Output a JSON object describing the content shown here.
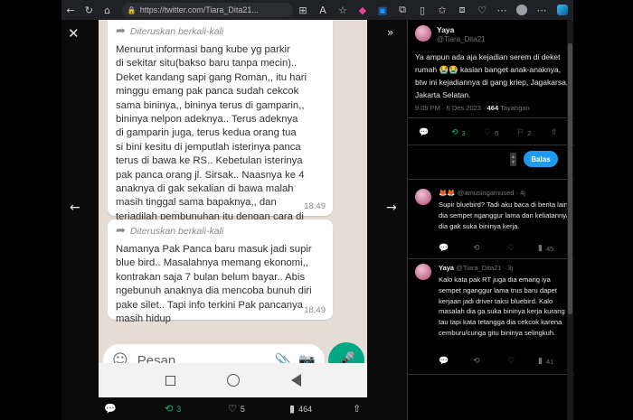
{
  "browser": {
    "url": "https://twitter.com/Tiara_Dita21..."
  },
  "whatsapp": {
    "forward_label_1": "Diteruskan berkali-kali",
    "message_1": "Menurut informasi bang kube yg parkir\ndi sekitar situ(bakso baru tanpa mecin)..\nDeket kandang sapi gang Roman,, itu hari\nminggu emang pak panca sudah cekcok\nsama bininya,, bininya terus di gamparin,,\nbininya nelpon adeknya.. Terus adeknya\ndi gamparin juga, terus kedua orang tua\nsi bini kesitu di jemputlah isterinya panca\nterus di bawa ke RS.. Kebetulan isterinya\npak panca orang jl. Sirsak.. Naasnya ke 4\nanaknya di gak sekalian di bawa malah\nmasih tinggal sama bapaknya,, dan\nterjadilah pembunuhan itu dengan cara di\nbekap dan di pukul..",
    "time_1": "18.49",
    "forward_label_2": "Diteruskan berkali-kali",
    "message_2": "Namanya Pak Panca baru masuk jadi supir\nblue bird.. Masalahnya memang ekonomi,,\nkontrakan saja 7 bulan belum bayar.. Abis\nngebunuh anaknya dia mencoba bunuh diri\npake silet.. Tapi info terkini Pak pancanya\nmasih hidup",
    "time_2": "18.49",
    "input_placeholder": "Pesan"
  },
  "bottom_bar": {
    "retweets": "3",
    "likes": "5",
    "views": "464"
  },
  "tweet": {
    "name": "Yaya",
    "handle": "@Tiara_Dita21",
    "text": "Ya ampun ada aja kejadian serem di deket rumah 😭😭 kasian banget anak-anaknya, btw ini kejadiannya di gang kriep, Jagakarsa, Jakarta Selatan.",
    "time": "9.09 PM · 6 Des 2023 · ",
    "views": "464",
    "views_label": " Tayangan",
    "retweets": "3",
    "likes": "5",
    "bookmarks": "2",
    "reply_button": "Balas"
  },
  "replies": [
    {
      "name": "🦊🦊",
      "handle": "@amusingamused · 4j",
      "text": "Supir bluebird? Tadi aku baca di berita lain, dia sempet nganggur lama dan keliatannya dia gak suka bininya kerja.",
      "views": "45"
    },
    {
      "name": "Yaya",
      "handle": "@Tiara_Dita21 · 3j",
      "text": "Kalo kata pak RT juga dia emang iya sempet nganggur lama trus baru dapet kerjaan jadi driver taksi bluebird. Kalo masalah dia ga suka bininya kerja kurang tau tapi kata tetangga dia cekcok karena cemburu/curiga gitu bininya selingkuh.",
      "views": "41"
    }
  ]
}
